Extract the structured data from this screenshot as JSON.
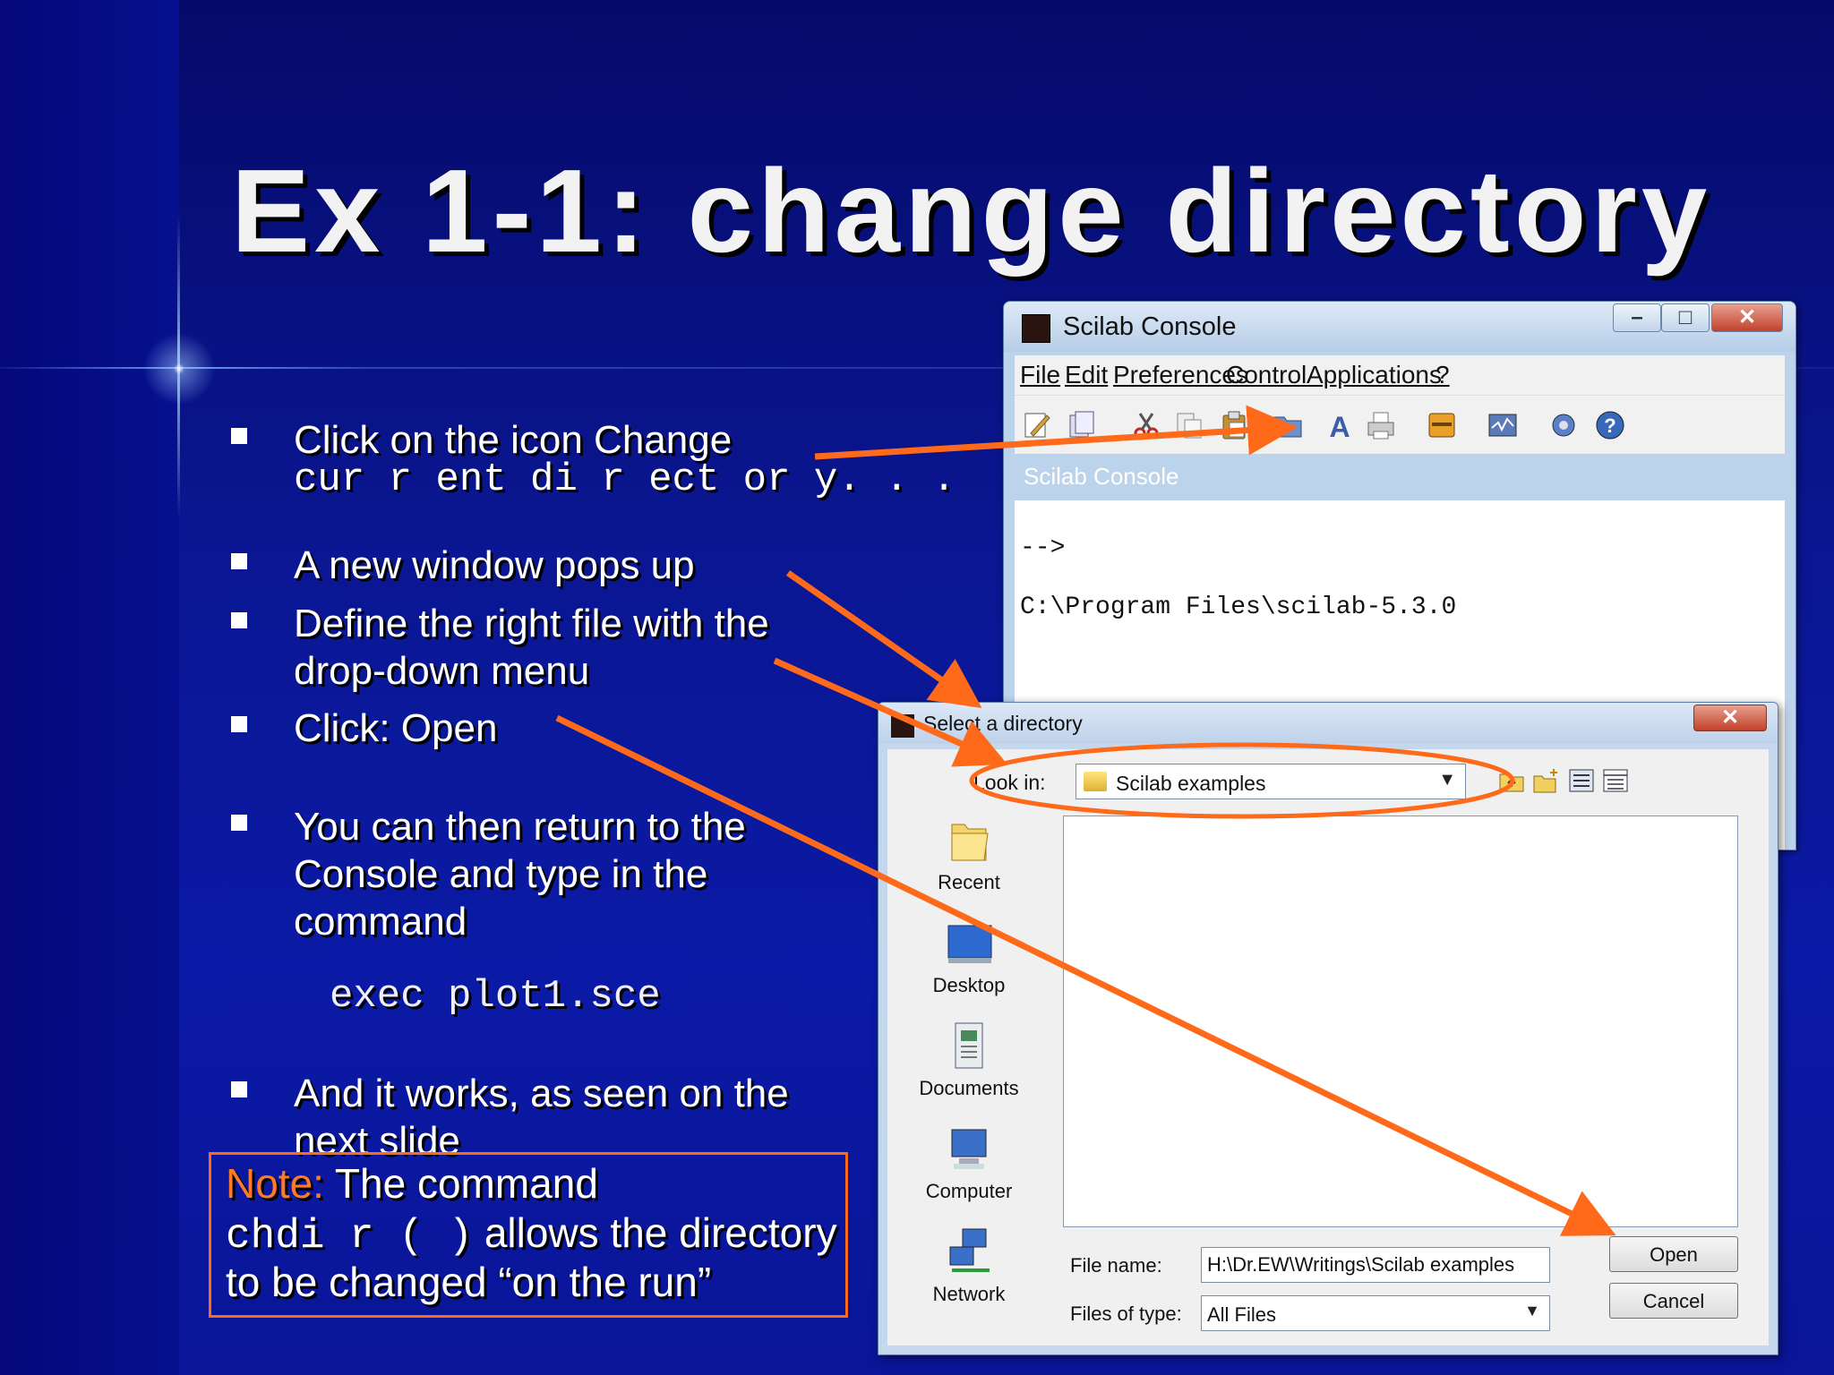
{
  "slide": {
    "title": "Ex 1-1: change directory",
    "bullets": [
      {
        "text": "Click on the icon Change"
      },
      {
        "text": "A new window pops up"
      },
      {
        "text": "Define the right file with the"
      },
      {
        "text": "Click: Open"
      },
      {
        "text": "You can then return to the"
      },
      {
        "text": "And it works, as seen on the"
      }
    ],
    "bullet1_line2": "cur r ent   di r ect or y. . .",
    "bullet3_line2": "drop-down menu",
    "bullet5_line2": "Console and type in the",
    "bullet5_line3": "command",
    "bullet6_line2": "next slide",
    "code": "exec plot1.sce",
    "note": {
      "label": "Note:",
      "line1": " The command",
      "code": "chdi r ( )",
      "line2_rest": "  allows the directory",
      "line3": "to be changed “on the run”"
    },
    "accent_color": "#ff6a1a"
  },
  "console": {
    "title": "Scilab Console",
    "menu": [
      "File",
      "Edit",
      "Preferences",
      "Control",
      "Applications",
      "?"
    ],
    "toolbar_icons": [
      "new-script-icon",
      "open-file-icon",
      "cut-icon",
      "copy-icon",
      "paste-icon",
      "change-directory-icon",
      "font-icon",
      "print-icon",
      "variable-browser-icon",
      "graphic-window-icon",
      "module-manager-icon",
      "help-icon"
    ],
    "label": "Scilab Console",
    "lines": [
      "-->",
      "C:\\Program Files\\scilab-5.3.0"
    ]
  },
  "dialog": {
    "title": "Select a directory",
    "look_in_label": "Look in:",
    "look_in_value": "Scilab examples",
    "places": [
      "Recent",
      "Desktop",
      "Documents",
      "Computer",
      "Network"
    ],
    "file_name_label": "File name:",
    "file_name_value": "H:\\Dr.EW\\Writings\\Scilab examples",
    "files_of_type_label": "Files of type:",
    "files_of_type_value": "All Files",
    "open_button": "Open",
    "cancel_button": "Cancel"
  }
}
